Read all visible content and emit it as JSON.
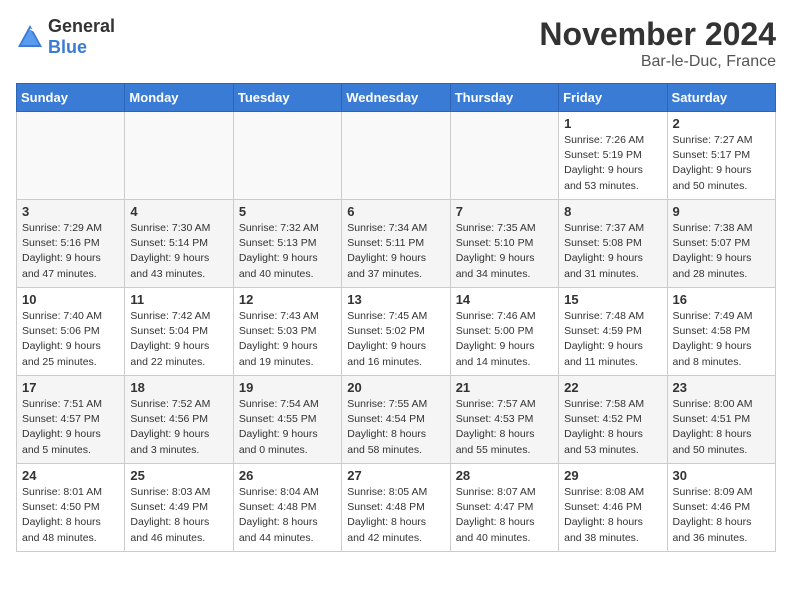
{
  "logo": {
    "text_general": "General",
    "text_blue": "Blue"
  },
  "title": "November 2024",
  "subtitle": "Bar-le-Duc, France",
  "days_of_week": [
    "Sunday",
    "Monday",
    "Tuesday",
    "Wednesday",
    "Thursday",
    "Friday",
    "Saturday"
  ],
  "weeks": [
    [
      {
        "day": "",
        "info": ""
      },
      {
        "day": "",
        "info": ""
      },
      {
        "day": "",
        "info": ""
      },
      {
        "day": "",
        "info": ""
      },
      {
        "day": "",
        "info": ""
      },
      {
        "day": "1",
        "info": "Sunrise: 7:26 AM\nSunset: 5:19 PM\nDaylight: 9 hours and 53 minutes."
      },
      {
        "day": "2",
        "info": "Sunrise: 7:27 AM\nSunset: 5:17 PM\nDaylight: 9 hours and 50 minutes."
      }
    ],
    [
      {
        "day": "3",
        "info": "Sunrise: 7:29 AM\nSunset: 5:16 PM\nDaylight: 9 hours and 47 minutes."
      },
      {
        "day": "4",
        "info": "Sunrise: 7:30 AM\nSunset: 5:14 PM\nDaylight: 9 hours and 43 minutes."
      },
      {
        "day": "5",
        "info": "Sunrise: 7:32 AM\nSunset: 5:13 PM\nDaylight: 9 hours and 40 minutes."
      },
      {
        "day": "6",
        "info": "Sunrise: 7:34 AM\nSunset: 5:11 PM\nDaylight: 9 hours and 37 minutes."
      },
      {
        "day": "7",
        "info": "Sunrise: 7:35 AM\nSunset: 5:10 PM\nDaylight: 9 hours and 34 minutes."
      },
      {
        "day": "8",
        "info": "Sunrise: 7:37 AM\nSunset: 5:08 PM\nDaylight: 9 hours and 31 minutes."
      },
      {
        "day": "9",
        "info": "Sunrise: 7:38 AM\nSunset: 5:07 PM\nDaylight: 9 hours and 28 minutes."
      }
    ],
    [
      {
        "day": "10",
        "info": "Sunrise: 7:40 AM\nSunset: 5:06 PM\nDaylight: 9 hours and 25 minutes."
      },
      {
        "day": "11",
        "info": "Sunrise: 7:42 AM\nSunset: 5:04 PM\nDaylight: 9 hours and 22 minutes."
      },
      {
        "day": "12",
        "info": "Sunrise: 7:43 AM\nSunset: 5:03 PM\nDaylight: 9 hours and 19 minutes."
      },
      {
        "day": "13",
        "info": "Sunrise: 7:45 AM\nSunset: 5:02 PM\nDaylight: 9 hours and 16 minutes."
      },
      {
        "day": "14",
        "info": "Sunrise: 7:46 AM\nSunset: 5:00 PM\nDaylight: 9 hours and 14 minutes."
      },
      {
        "day": "15",
        "info": "Sunrise: 7:48 AM\nSunset: 4:59 PM\nDaylight: 9 hours and 11 minutes."
      },
      {
        "day": "16",
        "info": "Sunrise: 7:49 AM\nSunset: 4:58 PM\nDaylight: 9 hours and 8 minutes."
      }
    ],
    [
      {
        "day": "17",
        "info": "Sunrise: 7:51 AM\nSunset: 4:57 PM\nDaylight: 9 hours and 5 minutes."
      },
      {
        "day": "18",
        "info": "Sunrise: 7:52 AM\nSunset: 4:56 PM\nDaylight: 9 hours and 3 minutes."
      },
      {
        "day": "19",
        "info": "Sunrise: 7:54 AM\nSunset: 4:55 PM\nDaylight: 9 hours and 0 minutes."
      },
      {
        "day": "20",
        "info": "Sunrise: 7:55 AM\nSunset: 4:54 PM\nDaylight: 8 hours and 58 minutes."
      },
      {
        "day": "21",
        "info": "Sunrise: 7:57 AM\nSunset: 4:53 PM\nDaylight: 8 hours and 55 minutes."
      },
      {
        "day": "22",
        "info": "Sunrise: 7:58 AM\nSunset: 4:52 PM\nDaylight: 8 hours and 53 minutes."
      },
      {
        "day": "23",
        "info": "Sunrise: 8:00 AM\nSunset: 4:51 PM\nDaylight: 8 hours and 50 minutes."
      }
    ],
    [
      {
        "day": "24",
        "info": "Sunrise: 8:01 AM\nSunset: 4:50 PM\nDaylight: 8 hours and 48 minutes."
      },
      {
        "day": "25",
        "info": "Sunrise: 8:03 AM\nSunset: 4:49 PM\nDaylight: 8 hours and 46 minutes."
      },
      {
        "day": "26",
        "info": "Sunrise: 8:04 AM\nSunset: 4:48 PM\nDaylight: 8 hours and 44 minutes."
      },
      {
        "day": "27",
        "info": "Sunrise: 8:05 AM\nSunset: 4:48 PM\nDaylight: 8 hours and 42 minutes."
      },
      {
        "day": "28",
        "info": "Sunrise: 8:07 AM\nSunset: 4:47 PM\nDaylight: 8 hours and 40 minutes."
      },
      {
        "day": "29",
        "info": "Sunrise: 8:08 AM\nSunset: 4:46 PM\nDaylight: 8 hours and 38 minutes."
      },
      {
        "day": "30",
        "info": "Sunrise: 8:09 AM\nSunset: 4:46 PM\nDaylight: 8 hours and 36 minutes."
      }
    ]
  ]
}
